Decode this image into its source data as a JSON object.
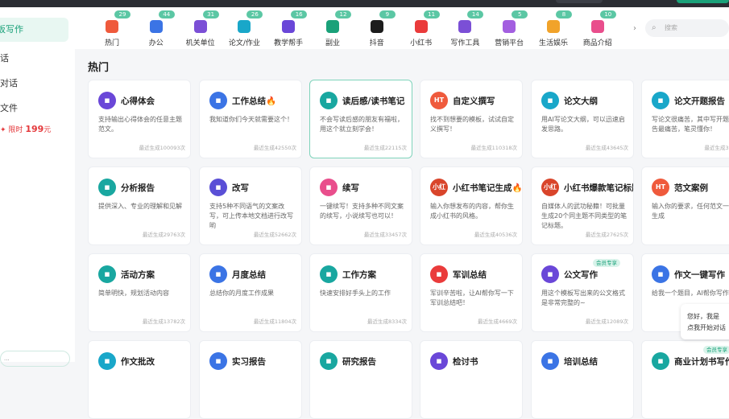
{
  "sidebar": {
    "items": [
      {
        "label": "板写作",
        "active": true
      },
      {
        "label": "话"
      },
      {
        "label": "对话"
      },
      {
        "label": "文件"
      }
    ],
    "promo": {
      "prefix": "限时",
      "price": "199",
      "suffix": "元"
    }
  },
  "categories": [
    {
      "label": "热门",
      "badge": "29",
      "color": "#ef5a3c"
    },
    {
      "label": "办公",
      "badge": "44",
      "color": "#3b74e5"
    },
    {
      "label": "机关单位",
      "badge": "31",
      "color": "#7b4fd6"
    },
    {
      "label": "论文/作业",
      "badge": "26",
      "color": "#19a7c9"
    },
    {
      "label": "教学帮手",
      "badge": "16",
      "color": "#6a47d8"
    },
    {
      "label": "副业",
      "badge": "12",
      "color": "#1aa179"
    },
    {
      "label": "抖音",
      "badge": "9",
      "color": "#1c1c1c"
    },
    {
      "label": "小红书",
      "badge": "11",
      "color": "#ea3b3b"
    },
    {
      "label": "写作工具",
      "badge": "14",
      "color": "#7b4fd6"
    },
    {
      "label": "营销平台",
      "badge": "5",
      "color": "#a35fe0"
    },
    {
      "label": "生活娱乐",
      "badge": "8",
      "color": "#f1a32a"
    },
    {
      "label": "商品介绍",
      "badge": "10",
      "color": "#e94e8c"
    }
  ],
  "search": {
    "placeholder": "搜索"
  },
  "section": {
    "title": "热门"
  },
  "cards": [
    {
      "title": "心得体会",
      "desc": "支持输出心得体会的任意主题范文。",
      "count": "最近生成100093次",
      "icon": "star-icon",
      "color": "#6a47d8"
    },
    {
      "title": "工作总结🔥",
      "desc": "我知道你们今天就需要这个！",
      "count": "最近生成42550次",
      "icon": "briefcase-icon",
      "color": "#3b74e5"
    },
    {
      "title": "读后感/读书笔记",
      "desc": "不会写读后感的朋友有福啦，用这个就立刻学会！",
      "count": "最近生成22115次",
      "icon": "book-icon",
      "color": "#19a7a0",
      "highlight": true
    },
    {
      "title": "自定义撰写",
      "desc": "找不到想要的模板，试试自定义撰写！",
      "count": "最近生成110318次",
      "icon": "ht-icon",
      "color": "#ef5a3c",
      "iconText": "HT"
    },
    {
      "title": "论文大纲",
      "desc": "用AI写论文大纲，可以迅速启发思路。",
      "count": "最近生成43645次",
      "icon": "outline-icon",
      "color": "#19a7c9"
    },
    {
      "title": "论文开题报告",
      "desc": "写论文很痛苦，其中写开题报告最痛苦，笔灵懂你！",
      "count": "最近生成3953",
      "icon": "report-icon",
      "color": "#19a7c9"
    },
    {
      "title": "分析报告",
      "desc": "提供深入、专业的理解和见解",
      "count": "最近生成29763次",
      "icon": "chart-icon",
      "color": "#19a7a0"
    },
    {
      "title": "改写",
      "desc": "支持5种不同语气的文案改写，可上传本地文档进行改写哟",
      "count": "最近生成52662次",
      "icon": "rewrite-icon",
      "color": "#5a4fd6"
    },
    {
      "title": "续写",
      "desc": "一键续写！支持多种不同文案的续写，小说续写也可以！",
      "count": "最近生成33457次",
      "icon": "continue-icon",
      "color": "#e94e8c"
    },
    {
      "title": "小红书笔记生成🔥",
      "desc": "输入你想发布的内容，帮你生成小红书的风格。",
      "count": "最近生成40536次",
      "icon": "xiaohongshu-icon",
      "color": "#d9452b",
      "iconText": "小红"
    },
    {
      "title": "小红书爆款笔记标题",
      "desc": "自媒体人的武功秘籍！可批量生成20个同主题不同类型的笔记标题。",
      "count": "最近生成27625次",
      "icon": "xiaohongshu-icon",
      "color": "#d9452b",
      "iconText": "小红"
    },
    {
      "title": "范文案例",
      "desc": "输入你的要求，任何范文一键生成",
      "count": "",
      "icon": "ht-icon",
      "color": "#ef5a3c",
      "iconText": "HT"
    },
    {
      "title": "活动方案",
      "desc": "简单明快，规划活动内容",
      "count": "最近生成13782次",
      "icon": "plan-icon",
      "color": "#19a7a0"
    },
    {
      "title": "月度总结",
      "desc": "总结你的月度工作成果",
      "count": "最近生成11804次",
      "icon": "briefcase-icon",
      "color": "#3b74e5"
    },
    {
      "title": "工作方案",
      "desc": "快速安排好手头上的工作",
      "count": "最近生成8334次",
      "icon": "plan-icon",
      "color": "#19a7a0"
    },
    {
      "title": "军训总结",
      "desc": "军训辛苦啦，让AI帮你写一下军训总结吧！",
      "count": "最近生成4669次",
      "icon": "book-icon",
      "color": "#ea3b3b"
    },
    {
      "title": "公文写作",
      "desc": "用这个模板写出来的公文格式是非常完整的~",
      "count": "最近生成12089次",
      "icon": "star-icon",
      "color": "#6a47d8",
      "tag": "会员专享"
    },
    {
      "title": "作文一键写作",
      "desc": "给我一个题目，AI帮你写作文",
      "count": "",
      "icon": "essay-icon",
      "color": "#3b74e5"
    },
    {
      "title": "作文批改",
      "desc": "",
      "count": "",
      "icon": "check-icon",
      "color": "#19a7c9"
    },
    {
      "title": "实习报告",
      "desc": "",
      "count": "",
      "icon": "briefcase-icon",
      "color": "#3b74e5"
    },
    {
      "title": "研究报告",
      "desc": "",
      "count": "",
      "icon": "book-icon",
      "color": "#19a7a0"
    },
    {
      "title": "检讨书",
      "desc": "",
      "count": "",
      "icon": "star-icon",
      "color": "#6a47d8"
    },
    {
      "title": "培训总结",
      "desc": "",
      "count": "",
      "icon": "briefcase-icon",
      "color": "#3b74e5"
    },
    {
      "title": "商业计划书写作",
      "desc": "",
      "count": "",
      "icon": "report-icon",
      "color": "#19a7a0",
      "tag": "会员专享"
    }
  ],
  "chat": {
    "line1": "您好，我是",
    "line2": "点我开始对话"
  },
  "bottom_bar": {
    "text": "..."
  }
}
